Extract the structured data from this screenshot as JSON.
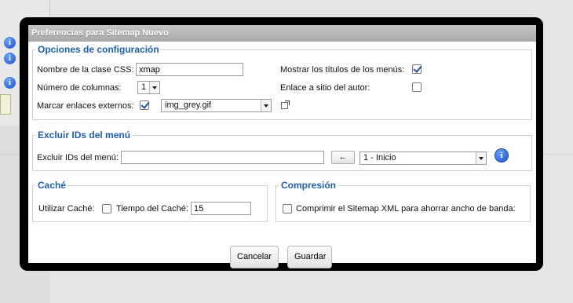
{
  "dialog": {
    "title": "Preferencias para Sitemap Nuevo"
  },
  "config": {
    "legend": "Opciones de configuración",
    "css_class_label": "Nombre de la clase CSS:",
    "css_class_value": "xmap",
    "columns_label": "Número de columnas:",
    "columns_value": "1",
    "external_links_label": "Marcar enlaces externos:",
    "external_links_checked": true,
    "external_image_value": "img_grey.gif",
    "show_titles_label": "Mostrar los títulos de los menús:",
    "show_titles_checked": true,
    "author_link_label": "Enlace a sitio del autor:",
    "author_link_checked": false
  },
  "exclude": {
    "legend": "Excluir IDs del menú",
    "label": "Excluir IDs del menú:",
    "value": "",
    "add_button": "←",
    "menu_select_value": "1 - Inicio"
  },
  "cache": {
    "legend": "Caché",
    "use_label": "Utilizar Caché:",
    "use_checked": false,
    "time_label": "Tiempo del Caché:",
    "time_value": "15"
  },
  "compression": {
    "legend": "Compresión",
    "label": "Comprimir el Sitemap XML para ahorrar ancho de banda:",
    "checked": false
  },
  "buttons": {
    "cancel": "Cancelar",
    "save": "Guardar"
  },
  "icons": {
    "info": "i"
  }
}
